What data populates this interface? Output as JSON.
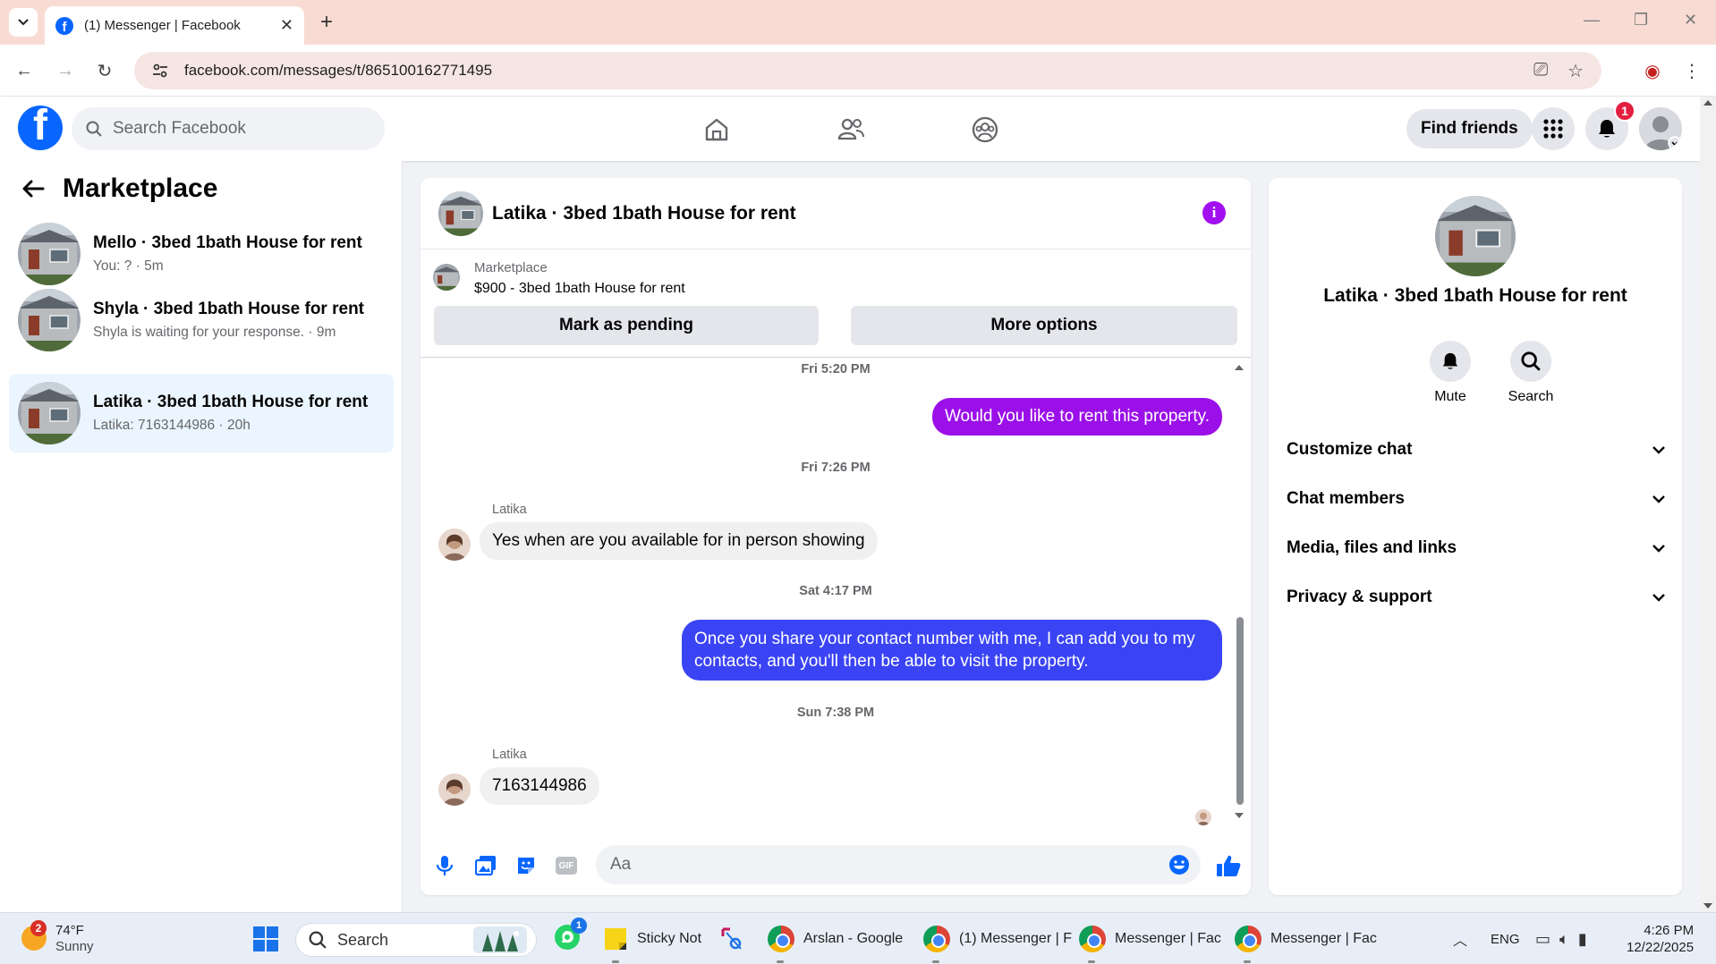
{
  "browser": {
    "tab_title": "(1) Messenger | Facebook",
    "url": "facebook.com/messages/t/865100162771495"
  },
  "header": {
    "search_placeholder": "Search Facebook",
    "find_friends": "Find friends",
    "notification_count": "1"
  },
  "sidebar": {
    "title": "Marketplace",
    "conversations": [
      {
        "name": "Mello · 3bed 1bath House for rent",
        "preview": "You: ? · 5m",
        "active": false
      },
      {
        "name": "Shyla · 3bed 1bath House for rent",
        "preview": "Shyla is waiting for your response. · 9m",
        "active": false
      },
      {
        "name": "Latika · 3bed 1bath House for rent",
        "preview": "Latika: 7163144986 · 20h",
        "active": true
      }
    ]
  },
  "chat": {
    "title": "Latika · 3bed 1bath House for rent",
    "listing_label": "Marketplace",
    "listing_price": "$900 - 3bed 1bath House for rent",
    "mark_pending": "Mark as pending",
    "more_options": "More options",
    "messages": {
      "ts1": "Fri 5:20 PM",
      "out1": "Would you like to rent this property.",
      "ts2": "Fri 7:26 PM",
      "sender2": "Latika",
      "in2": "Yes when are you available for in person showing",
      "ts3": "Sat 4:17 PM",
      "out3": "Once you share your contact number with me, I can add you to my contacts, and you'll then be able to visit the property.",
      "ts4": "Sun 7:38 PM",
      "sender4": "Latika",
      "in4": "7163144986"
    },
    "composer_placeholder": "Aa",
    "gif_label": "GIF",
    "colors": {
      "out_purple": "#9b10e8",
      "out_blue": "#3a44f5",
      "accent": "#a20ff0"
    }
  },
  "info_panel": {
    "name": "Latika · 3bed 1bath House for rent",
    "mute": "Mute",
    "search": "Search",
    "sections": [
      "Customize chat",
      "Chat members",
      "Media, files and links",
      "Privacy & support"
    ]
  },
  "taskbar": {
    "weather_temp": "74°F",
    "weather_desc": "Sunny",
    "weather_badge": "2",
    "search": "Search",
    "whatsapp_badge": "1",
    "apps": [
      "Sticky Not",
      "Arslan - Google",
      "(1) Messenger | F",
      "Messenger | Fac",
      "Messenger | Fac"
    ],
    "lang": "ENG",
    "time": "4:26 PM",
    "date": "12/22/2025"
  }
}
